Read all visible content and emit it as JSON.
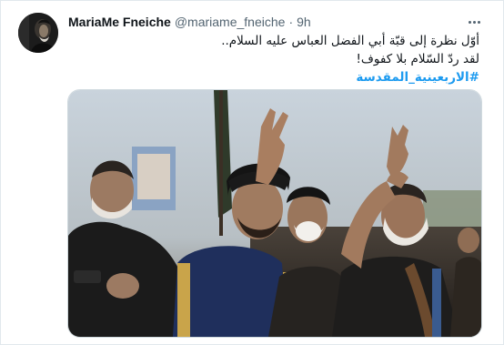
{
  "tweet": {
    "author": {
      "display_name": "MariaMe Fneiche",
      "handle": "@mariame_fneiche",
      "avatar_icon": "profile-avatar"
    },
    "separator": "·",
    "time": "9h",
    "more_icon": "more-horizontal-icon",
    "text_lines": [
      "أوّل نظرة إلى قبّة أبي الفضل العباس عليه السلام..",
      "لقد ردّ السّلام بلا كفوف!"
    ],
    "hashtag": "#الاربعينية_المقدسة",
    "media": {
      "kind": "photo",
      "subject": "pilgrims-crowd-photo"
    },
    "colors": {
      "link": "#1d9bf0",
      "text": "#0f1419",
      "secondary": "#536471",
      "border": "#cfd9de"
    }
  }
}
